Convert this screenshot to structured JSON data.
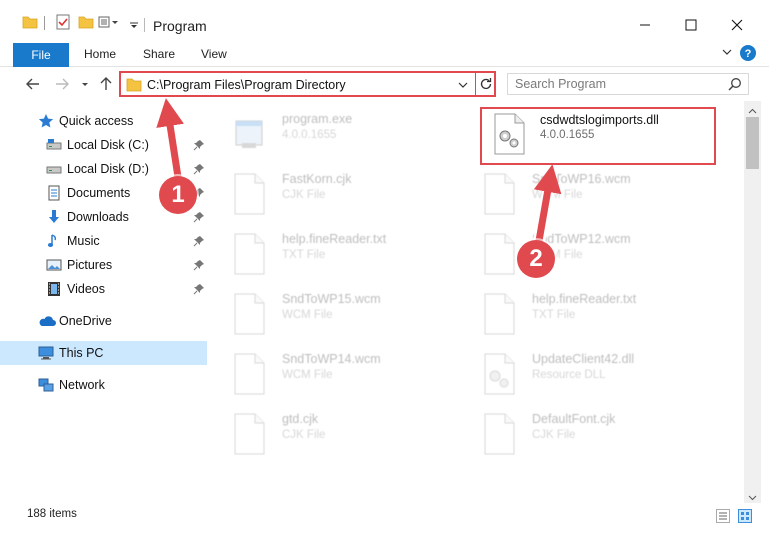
{
  "window": {
    "title": "Program"
  },
  "ribbon": {
    "tabs": [
      "File",
      "Home",
      "Share",
      "View"
    ]
  },
  "address": {
    "path": "C:\\Program Files\\Program Directory"
  },
  "search": {
    "placeholder": "Search Program"
  },
  "sidebar": {
    "quick_access": "Quick access",
    "items": [
      {
        "label": "Local Disk (C:)",
        "icon": "drive-icon",
        "pinned": true
      },
      {
        "label": "Local Disk (D:)",
        "icon": "drive-icon",
        "pinned": true
      },
      {
        "label": "Documents",
        "icon": "documents-icon",
        "pinned": true
      },
      {
        "label": "Downloads",
        "icon": "downloads-icon",
        "pinned": true
      },
      {
        "label": "Music",
        "icon": "music-icon",
        "pinned": true
      },
      {
        "label": "Pictures",
        "icon": "pictures-icon",
        "pinned": true
      },
      {
        "label": "Videos",
        "icon": "videos-icon",
        "pinned": true
      }
    ],
    "onedrive": "OneDrive",
    "this_pc": "This PC",
    "network": "Network"
  },
  "files": [
    {
      "name": "program.exe",
      "meta": "4.0.0.1655",
      "icon": "exe-icon",
      "faded": true
    },
    {
      "name": "csdwdtslogimports.dll",
      "meta": "4.0.0.1655",
      "icon": "dll-icon",
      "faded": false,
      "highlighted": true
    },
    {
      "name": "FastKorn.cjk",
      "meta": "CJK File",
      "icon": "file-icon",
      "faded": true
    },
    {
      "name": "SndToWP16.wcm",
      "meta": "WCM File",
      "icon": "file-icon",
      "faded": true
    },
    {
      "name": "help.fineReader.txt",
      "meta": "TXT File",
      "icon": "file-icon",
      "faded": true
    },
    {
      "name": "SndToWP12.wcm",
      "meta": "WCM File",
      "icon": "file-icon",
      "faded": true
    },
    {
      "name": "SndToWP15.wcm",
      "meta": "WCM File",
      "icon": "file-icon",
      "faded": true
    },
    {
      "name": "help.fineReader.txt",
      "meta": "TXT File",
      "icon": "file-icon",
      "faded": true
    },
    {
      "name": "SndToWP14.wcm",
      "meta": "WCM File",
      "icon": "file-icon",
      "faded": true
    },
    {
      "name": "UpdateClient42.dll",
      "meta": "Resource DLL",
      "icon": "dll-icon",
      "faded": true
    },
    {
      "name": "gtd.cjk",
      "meta": "CJK File",
      "icon": "file-icon",
      "faded": true
    },
    {
      "name": "DefaultFont.cjk",
      "meta": "CJK File",
      "icon": "file-icon",
      "faded": true
    }
  ],
  "status": {
    "item_count": "188 items"
  },
  "annotations": {
    "step1": "1",
    "step2": "2",
    "color": "#e04a4f"
  },
  "colors": {
    "accent": "#1979ca",
    "selection": "#cce8ff",
    "annotation": "#e04a4f"
  }
}
